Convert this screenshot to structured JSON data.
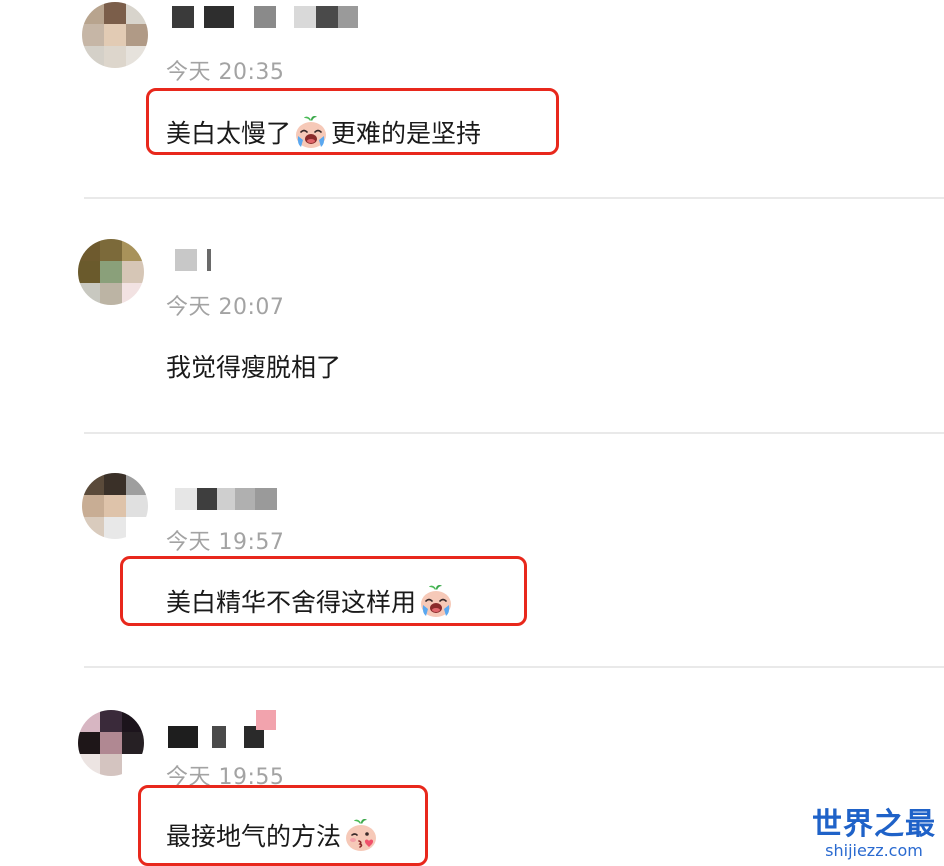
{
  "comments": [
    {
      "username": "",
      "time": "今天 20:35",
      "text_before": "美白太慢了",
      "emoji": "crying-baby-emoji",
      "text_after": "更难的是坚持",
      "highlighted": true
    },
    {
      "username": "",
      "time": "今天 20:07",
      "text_before": "我觉得瘦脱相了",
      "emoji": "",
      "text_after": "",
      "highlighted": false
    },
    {
      "username": "",
      "time": "今天 19:57",
      "text_before": "美白精华不舍得这样用",
      "emoji": "crying-baby-emoji",
      "text_after": "",
      "highlighted": true
    },
    {
      "username": "",
      "time": "今天 19:55",
      "text_before": "最接地气的方法",
      "emoji": "kissing-baby-emoji",
      "text_after": "",
      "highlighted": true
    }
  ],
  "colors": {
    "highlight_border": "#e8281c",
    "timestamp": "#a3a3a3",
    "divider": "#e9e9e9",
    "watermark": "#1f62c8"
  },
  "watermark": {
    "title": "世界之最",
    "url": "shijiezz.com"
  }
}
